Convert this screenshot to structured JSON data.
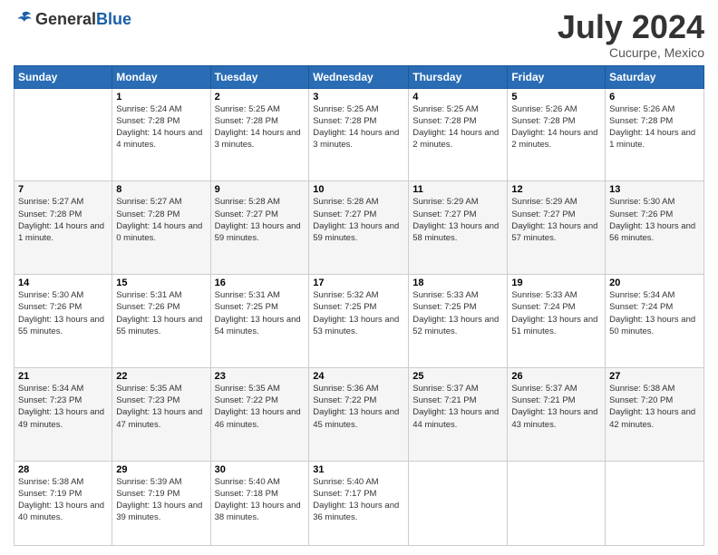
{
  "header": {
    "logo": {
      "general": "General",
      "blue": "Blue"
    },
    "title": "July 2024",
    "location": "Cucurpe, Mexico"
  },
  "weekdays": [
    "Sunday",
    "Monday",
    "Tuesday",
    "Wednesday",
    "Thursday",
    "Friday",
    "Saturday"
  ],
  "weeks": [
    [
      {
        "day": "",
        "sunrise": "",
        "sunset": "",
        "daylight": ""
      },
      {
        "day": "1",
        "sunrise": "Sunrise: 5:24 AM",
        "sunset": "Sunset: 7:28 PM",
        "daylight": "Daylight: 14 hours and 4 minutes."
      },
      {
        "day": "2",
        "sunrise": "Sunrise: 5:25 AM",
        "sunset": "Sunset: 7:28 PM",
        "daylight": "Daylight: 14 hours and 3 minutes."
      },
      {
        "day": "3",
        "sunrise": "Sunrise: 5:25 AM",
        "sunset": "Sunset: 7:28 PM",
        "daylight": "Daylight: 14 hours and 3 minutes."
      },
      {
        "day": "4",
        "sunrise": "Sunrise: 5:25 AM",
        "sunset": "Sunset: 7:28 PM",
        "daylight": "Daylight: 14 hours and 2 minutes."
      },
      {
        "day": "5",
        "sunrise": "Sunrise: 5:26 AM",
        "sunset": "Sunset: 7:28 PM",
        "daylight": "Daylight: 14 hours and 2 minutes."
      },
      {
        "day": "6",
        "sunrise": "Sunrise: 5:26 AM",
        "sunset": "Sunset: 7:28 PM",
        "daylight": "Daylight: 14 hours and 1 minute."
      }
    ],
    [
      {
        "day": "7",
        "sunrise": "Sunrise: 5:27 AM",
        "sunset": "Sunset: 7:28 PM",
        "daylight": "Daylight: 14 hours and 1 minute."
      },
      {
        "day": "8",
        "sunrise": "Sunrise: 5:27 AM",
        "sunset": "Sunset: 7:28 PM",
        "daylight": "Daylight: 14 hours and 0 minutes."
      },
      {
        "day": "9",
        "sunrise": "Sunrise: 5:28 AM",
        "sunset": "Sunset: 7:27 PM",
        "daylight": "Daylight: 13 hours and 59 minutes."
      },
      {
        "day": "10",
        "sunrise": "Sunrise: 5:28 AM",
        "sunset": "Sunset: 7:27 PM",
        "daylight": "Daylight: 13 hours and 59 minutes."
      },
      {
        "day": "11",
        "sunrise": "Sunrise: 5:29 AM",
        "sunset": "Sunset: 7:27 PM",
        "daylight": "Daylight: 13 hours and 58 minutes."
      },
      {
        "day": "12",
        "sunrise": "Sunrise: 5:29 AM",
        "sunset": "Sunset: 7:27 PM",
        "daylight": "Daylight: 13 hours and 57 minutes."
      },
      {
        "day": "13",
        "sunrise": "Sunrise: 5:30 AM",
        "sunset": "Sunset: 7:26 PM",
        "daylight": "Daylight: 13 hours and 56 minutes."
      }
    ],
    [
      {
        "day": "14",
        "sunrise": "Sunrise: 5:30 AM",
        "sunset": "Sunset: 7:26 PM",
        "daylight": "Daylight: 13 hours and 55 minutes."
      },
      {
        "day": "15",
        "sunrise": "Sunrise: 5:31 AM",
        "sunset": "Sunset: 7:26 PM",
        "daylight": "Daylight: 13 hours and 55 minutes."
      },
      {
        "day": "16",
        "sunrise": "Sunrise: 5:31 AM",
        "sunset": "Sunset: 7:25 PM",
        "daylight": "Daylight: 13 hours and 54 minutes."
      },
      {
        "day": "17",
        "sunrise": "Sunrise: 5:32 AM",
        "sunset": "Sunset: 7:25 PM",
        "daylight": "Daylight: 13 hours and 53 minutes."
      },
      {
        "day": "18",
        "sunrise": "Sunrise: 5:33 AM",
        "sunset": "Sunset: 7:25 PM",
        "daylight": "Daylight: 13 hours and 52 minutes."
      },
      {
        "day": "19",
        "sunrise": "Sunrise: 5:33 AM",
        "sunset": "Sunset: 7:24 PM",
        "daylight": "Daylight: 13 hours and 51 minutes."
      },
      {
        "day": "20",
        "sunrise": "Sunrise: 5:34 AM",
        "sunset": "Sunset: 7:24 PM",
        "daylight": "Daylight: 13 hours and 50 minutes."
      }
    ],
    [
      {
        "day": "21",
        "sunrise": "Sunrise: 5:34 AM",
        "sunset": "Sunset: 7:23 PM",
        "daylight": "Daylight: 13 hours and 49 minutes."
      },
      {
        "day": "22",
        "sunrise": "Sunrise: 5:35 AM",
        "sunset": "Sunset: 7:23 PM",
        "daylight": "Daylight: 13 hours and 47 minutes."
      },
      {
        "day": "23",
        "sunrise": "Sunrise: 5:35 AM",
        "sunset": "Sunset: 7:22 PM",
        "daylight": "Daylight: 13 hours and 46 minutes."
      },
      {
        "day": "24",
        "sunrise": "Sunrise: 5:36 AM",
        "sunset": "Sunset: 7:22 PM",
        "daylight": "Daylight: 13 hours and 45 minutes."
      },
      {
        "day": "25",
        "sunrise": "Sunrise: 5:37 AM",
        "sunset": "Sunset: 7:21 PM",
        "daylight": "Daylight: 13 hours and 44 minutes."
      },
      {
        "day": "26",
        "sunrise": "Sunrise: 5:37 AM",
        "sunset": "Sunset: 7:21 PM",
        "daylight": "Daylight: 13 hours and 43 minutes."
      },
      {
        "day": "27",
        "sunrise": "Sunrise: 5:38 AM",
        "sunset": "Sunset: 7:20 PM",
        "daylight": "Daylight: 13 hours and 42 minutes."
      }
    ],
    [
      {
        "day": "28",
        "sunrise": "Sunrise: 5:38 AM",
        "sunset": "Sunset: 7:19 PM",
        "daylight": "Daylight: 13 hours and 40 minutes."
      },
      {
        "day": "29",
        "sunrise": "Sunrise: 5:39 AM",
        "sunset": "Sunset: 7:19 PM",
        "daylight": "Daylight: 13 hours and 39 minutes."
      },
      {
        "day": "30",
        "sunrise": "Sunrise: 5:40 AM",
        "sunset": "Sunset: 7:18 PM",
        "daylight": "Daylight: 13 hours and 38 minutes."
      },
      {
        "day": "31",
        "sunrise": "Sunrise: 5:40 AM",
        "sunset": "Sunset: 7:17 PM",
        "daylight": "Daylight: 13 hours and 36 minutes."
      },
      {
        "day": "",
        "sunrise": "",
        "sunset": "",
        "daylight": ""
      },
      {
        "day": "",
        "sunrise": "",
        "sunset": "",
        "daylight": ""
      },
      {
        "day": "",
        "sunrise": "",
        "sunset": "",
        "daylight": ""
      }
    ]
  ]
}
